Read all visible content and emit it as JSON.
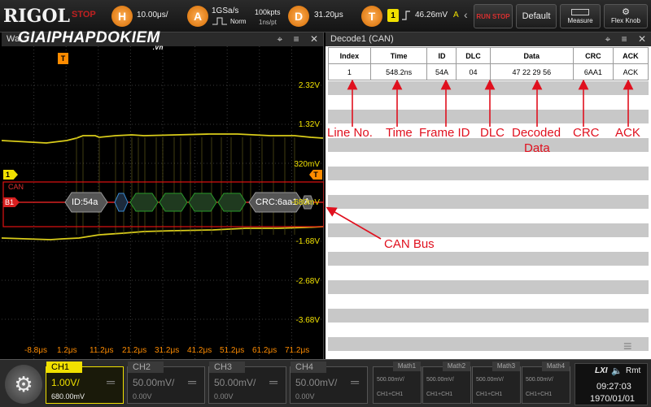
{
  "topbar": {
    "brand": "RIGOL",
    "run_status": "STOP",
    "horizontal": {
      "key": "H",
      "timebase": "10.00μs/"
    },
    "acquire": {
      "key": "A",
      "sample_rate": "1GSa/s",
      "mode": "Norm",
      "memory": "100kpts",
      "resolution": "1ns/pt"
    },
    "delay": {
      "key": "D",
      "value": "31.20μs"
    },
    "trigger": {
      "key": "T",
      "channel": "1",
      "level": "46.26mV",
      "coupling": "A"
    },
    "run_stop_label": "RUN STOP",
    "default_label": "Default",
    "measure_label": "Measure",
    "flexknob_label": "Flex Knob",
    "colors": {
      "accent": "#ff8c00",
      "ch1": "#f0e000",
      "annotation": "#e0101e"
    }
  },
  "watermark": {
    "text": "GIAIPHAPDOKIEM",
    "suffix": ".vn"
  },
  "waveform": {
    "title": "Wa",
    "trigger_marker": "T",
    "right_labels": [
      "2.32V",
      "1.32V",
      "320mV",
      "-680mV",
      "-1.68V",
      "-2.68V",
      "-3.68V"
    ],
    "ch1_marker": "1",
    "trig_level_marker": "T",
    "bus_label": "CAN",
    "bus_marker": "B1",
    "decode_labels": {
      "id": "ID:54a",
      "crc": "CRC:6aa1",
      "ack": "A"
    },
    "x_ticks": [
      "-8.8μs",
      "1.2μs",
      "11.2μs",
      "21.2μs",
      "31.2μs",
      "41.2μs",
      "51.2μs",
      "61.2μs",
      "71.2μs"
    ]
  },
  "decode": {
    "title": "Decode1 (CAN)",
    "columns": [
      "Index",
      "Time",
      "ID",
      "DLC",
      "Data",
      "CRC",
      "ACK"
    ],
    "rows": [
      [
        "1",
        "548.2ns",
        "54A",
        "04",
        "47 22 29 56",
        "6AA1",
        "ACK"
      ]
    ]
  },
  "annotations": {
    "line_no": "Line No.",
    "time": "Time",
    "frame_id": "Frame ID",
    "dlc": "DLC",
    "decoded": "Decoded",
    "data": "Data",
    "crc": "CRC",
    "ack": "ACK",
    "can_bus": "CAN Bus"
  },
  "channels": [
    {
      "name": "CH1",
      "scale": "1.00V/",
      "offset": "680.00mV",
      "active": true
    },
    {
      "name": "CH2",
      "scale": "50.00mV/",
      "offset": "0.00V",
      "active": false
    },
    {
      "name": "CH3",
      "scale": "50.00mV/",
      "offset": "0.00V",
      "active": false
    },
    {
      "name": "CH4",
      "scale": "50.00mV/",
      "offset": "0.00V",
      "active": false
    }
  ],
  "math": [
    {
      "name": "Math1",
      "scale": "500.00mV/",
      "expr": "CH1+CH1"
    },
    {
      "name": "Math2",
      "scale": "500.00mV/",
      "expr": "CH1+CH1"
    },
    {
      "name": "Math3",
      "scale": "500.00mV/",
      "expr": "CH1+CH1"
    },
    {
      "name": "Math4",
      "scale": "500.00mV/",
      "expr": "CH1+CH1"
    }
  ],
  "status": {
    "lxi": "LXI",
    "rmt": "Rmt",
    "time": "09:27:03",
    "date": "1970/01/01"
  }
}
